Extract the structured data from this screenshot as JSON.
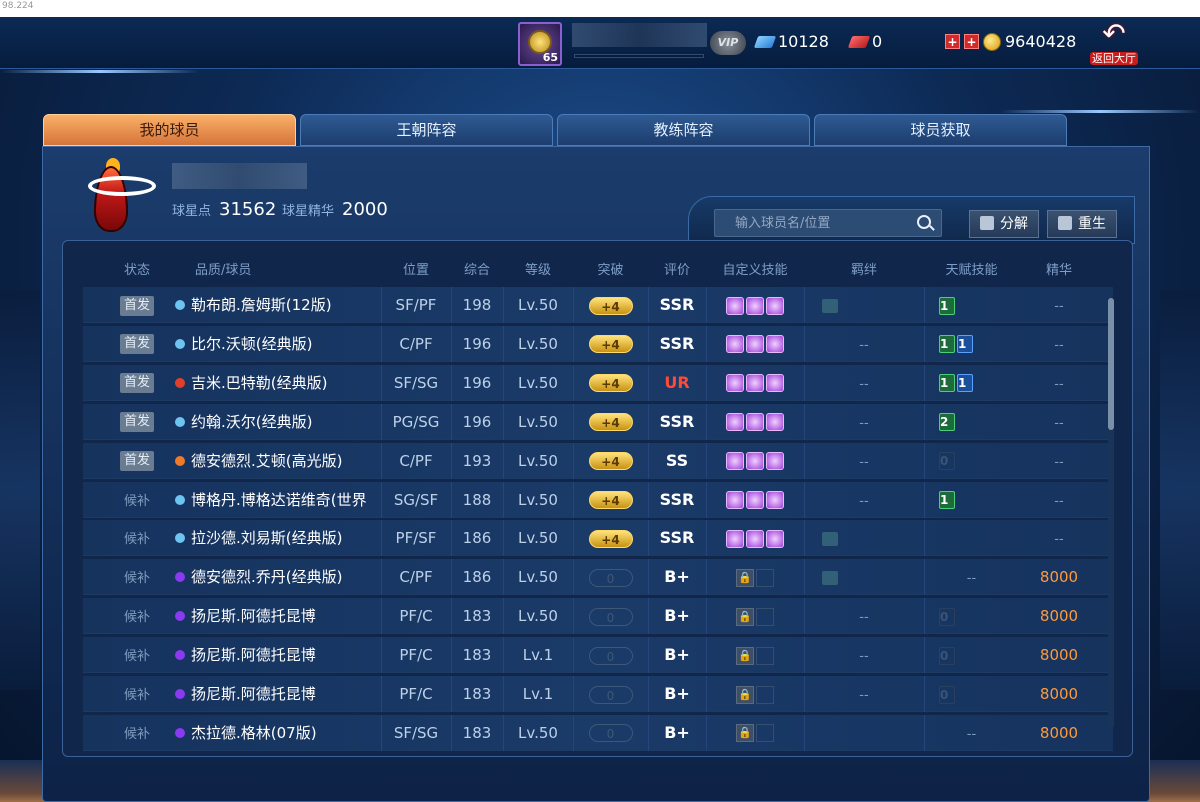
{
  "ip_text": "98.224",
  "topbar": {
    "level": "65",
    "vip_label": "VIP",
    "diamonds": "10128",
    "tickets": "0",
    "coins": "9640428",
    "plus_label": "+",
    "back_label": "返回大厅"
  },
  "tabs": [
    "我的球员",
    "王朝阵容",
    "教练阵容",
    "球员获取"
  ],
  "team": {
    "star_points_label": "球星点",
    "star_points": "31562",
    "essence_label": "球星精华",
    "essence": "2000"
  },
  "search": {
    "placeholder": "输入球员名/位置"
  },
  "buttons": {
    "decompose": "分解",
    "rebirth": "重生"
  },
  "headers": [
    "状态",
    "品质/球员",
    "位置",
    "综合",
    "等级",
    "突破",
    "评价",
    "自定义技能",
    "羁绊",
    "天赋技能",
    "精华"
  ],
  "rows": [
    {
      "status": "首发",
      "starter": true,
      "dot": "#6ec3f0",
      "name": "勒布朗.詹姆斯(12版)",
      "pos": "SF/PF",
      "ovr": "198",
      "lvl": "Lv.50",
      "brk": "+4",
      "grade": "SSR",
      "skills": 3,
      "bond": true,
      "talents": [
        "1"
      ],
      "talent_colors": [
        "g"
      ],
      "essence": "--"
    },
    {
      "status": "首发",
      "starter": true,
      "dot": "#6ec3f0",
      "name": "比尔.沃顿(经典版)",
      "pos": "C/PF",
      "ovr": "196",
      "lvl": "Lv.50",
      "brk": "+4",
      "grade": "SSR",
      "skills": 3,
      "bond": false,
      "talents": [
        "1",
        "1"
      ],
      "talent_colors": [
        "g",
        "b"
      ],
      "essence": "--"
    },
    {
      "status": "首发",
      "starter": true,
      "dot": "#e0402a",
      "name": "吉米.巴特勒(经典版)",
      "pos": "SF/SG",
      "ovr": "196",
      "lvl": "Lv.50",
      "brk": "+4",
      "grade": "UR",
      "skills": 3,
      "bond": false,
      "talents": [
        "1",
        "1"
      ],
      "talent_colors": [
        "g",
        "b"
      ],
      "essence": "--"
    },
    {
      "status": "首发",
      "starter": true,
      "dot": "#6ec3f0",
      "name": "约翰.沃尔(经典版)",
      "pos": "PG/SG",
      "ovr": "196",
      "lvl": "Lv.50",
      "brk": "+4",
      "grade": "SSR",
      "skills": 3,
      "bond": false,
      "talents": [
        "2"
      ],
      "talent_colors": [
        "g"
      ],
      "essence": "--"
    },
    {
      "status": "首发",
      "starter": true,
      "dot": "#f07a2a",
      "name": "德安德烈.艾顿(高光版)",
      "pos": "C/PF",
      "ovr": "193",
      "lvl": "Lv.50",
      "brk": "+4",
      "grade": "SS",
      "skills": 3,
      "bond": false,
      "talents": [
        "0"
      ],
      "talent_colors": [
        "o"
      ],
      "essence": "--"
    },
    {
      "status": "候补",
      "starter": false,
      "dot": "#6ec3f0",
      "name": "博格丹.博格达诺维奇(世界版)",
      "pos": "SG/SF",
      "ovr": "188",
      "lvl": "Lv.50",
      "brk": "+4",
      "grade": "SSR",
      "skills": 3,
      "bond": false,
      "talents": [
        "1"
      ],
      "talent_colors": [
        "g"
      ],
      "essence": "--"
    },
    {
      "status": "候补",
      "starter": false,
      "dot": "#6ec3f0",
      "name": "拉沙德.刘易斯(经典版)",
      "pos": "PF/SF",
      "ovr": "186",
      "lvl": "Lv.50",
      "brk": "+4",
      "grade": "SSR",
      "skills": 3,
      "bond": true,
      "talents": [],
      "talent_colors": [],
      "essence": "--"
    },
    {
      "status": "候补",
      "starter": false,
      "dot": "#8a3af0",
      "name": "德安德烈.乔丹(经典版)",
      "pos": "C/PF",
      "ovr": "186",
      "lvl": "Lv.50",
      "brk": "0",
      "grade": "B+",
      "skills": 0,
      "bond": true,
      "talents": [],
      "talent_colors": [],
      "essence": "8000"
    },
    {
      "status": "候补",
      "starter": false,
      "dot": "#8a3af0",
      "name": "扬尼斯.阿德托昆博",
      "pos": "PF/C",
      "ovr": "183",
      "lvl": "Lv.50",
      "brk": "0",
      "grade": "B+",
      "skills": 0,
      "bond": false,
      "talents": [
        "0"
      ],
      "talent_colors": [
        "o"
      ],
      "essence": "8000"
    },
    {
      "status": "候补",
      "starter": false,
      "dot": "#8a3af0",
      "name": "扬尼斯.阿德托昆博",
      "pos": "PF/C",
      "ovr": "183",
      "lvl": "Lv.1",
      "brk": "0",
      "grade": "B+",
      "skills": 0,
      "bond": false,
      "talents": [
        "0"
      ],
      "talent_colors": [
        "o"
      ],
      "essence": "8000"
    },
    {
      "status": "候补",
      "starter": false,
      "dot": "#8a3af0",
      "name": "扬尼斯.阿德托昆博",
      "pos": "PF/C",
      "ovr": "183",
      "lvl": "Lv.1",
      "brk": "0",
      "grade": "B+",
      "skills": 0,
      "bond": false,
      "talents": [
        "0"
      ],
      "talent_colors": [
        "o"
      ],
      "essence": "8000"
    },
    {
      "status": "候补",
      "starter": false,
      "dot": "#8a3af0",
      "name": "杰拉德.格林(07版)",
      "pos": "SF/SG",
      "ovr": "183",
      "lvl": "Lv.50",
      "brk": "0",
      "grade": "B+",
      "skills": 0,
      "bond": false,
      "talents": [],
      "talent_colors": [],
      "essence": "8000"
    }
  ],
  "empty_mark": "--",
  "lock_glyph": "🔒"
}
